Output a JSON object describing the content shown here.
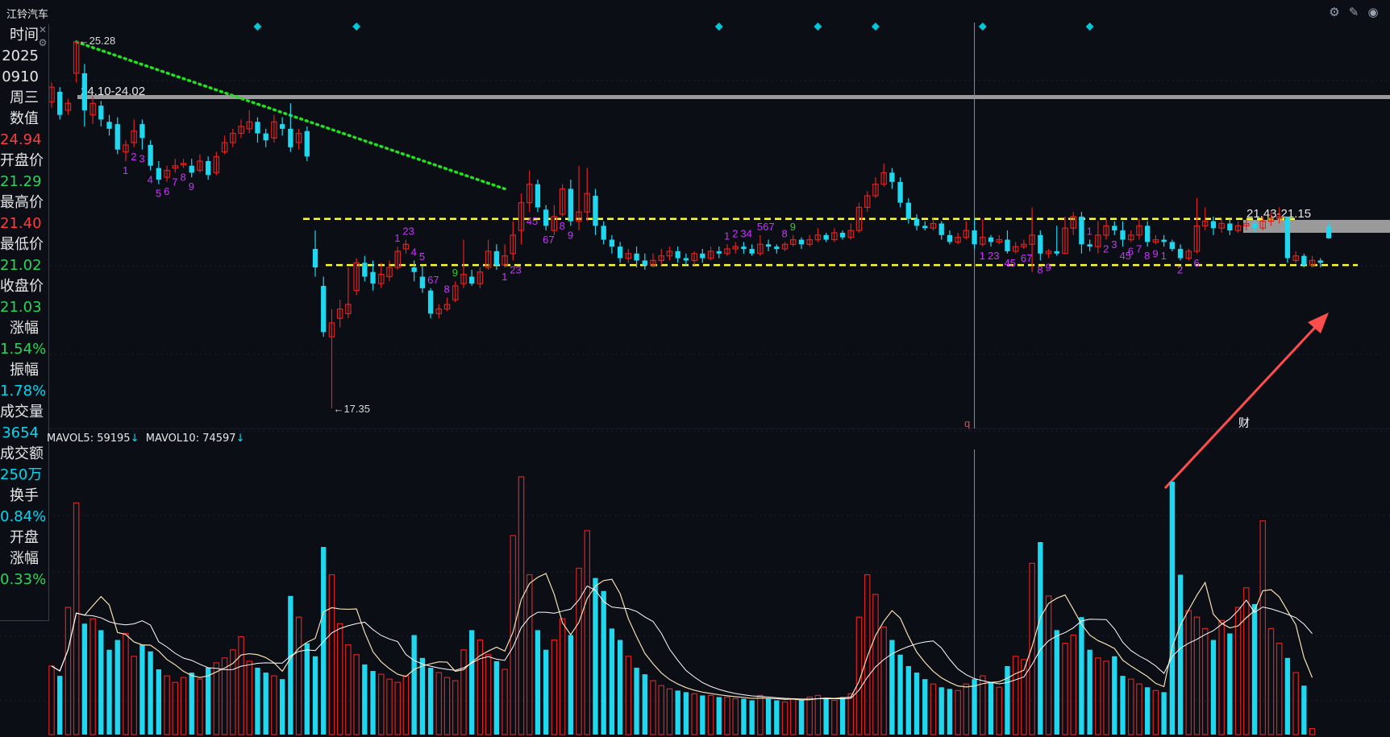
{
  "window": {
    "stock_name": "江铃汽车",
    "icons": [
      "settings-icon",
      "draw-pen-icon",
      "eye-icon"
    ]
  },
  "info_panel": {
    "rows": [
      {
        "label": "时间",
        "value": "2025",
        "color": "#e6e6e6"
      },
      {
        "label": "",
        "value": "0910",
        "color": "#e6e6e6"
      },
      {
        "label": "",
        "value": "周三",
        "color": "#e6e6e6"
      },
      {
        "label": "数值",
        "value": "24.94",
        "color": "#ff3b3b"
      },
      {
        "label": "开盘价",
        "value": "21.29",
        "color": "#2bd45a"
      },
      {
        "label": "最高价",
        "value": "21.40",
        "color": "#ff3b3b"
      },
      {
        "label": "最低价",
        "value": "21.02",
        "color": "#2bd45a"
      },
      {
        "label": "收盘价",
        "value": "21.03",
        "color": "#2bd45a"
      },
      {
        "label": "涨幅",
        "value": "1.54%",
        "color": "#2bd45a"
      },
      {
        "label": "振幅",
        "value": "1.78%",
        "color": "#00d8f0"
      },
      {
        "label": "成交量",
        "value": "3654",
        "color": "#00d8f0"
      },
      {
        "label": "成交额",
        "value": "250万",
        "color": "#00d8f0"
      },
      {
        "label": "换手",
        "value": "0.84%",
        "color": "#00d8f0"
      },
      {
        "label": "开盘",
        "value": "",
        "color": "#e6e6e6"
      },
      {
        "label": "涨幅",
        "value": "0.33%",
        "color": "#2bd45a"
      }
    ]
  },
  "volume_legend": {
    "mavol5_label": "MAVOL5: 59195",
    "mavol10_label": "MAVOL10: 74597",
    "arrow": "↓"
  },
  "colors": {
    "up": "#e02020",
    "down": "#1fd8f0",
    "trendline": "#20e020",
    "support": "#ffff33",
    "td_count": "#cc33ff",
    "td_green": "#33cc33",
    "annotation_arrow": "#ff4d4d",
    "marker": "#00c8d8",
    "resistance_band": "#9a9a9a",
    "mavol5": "#f5deb3",
    "mavol10": "#ffffff"
  },
  "chart_data": {
    "type": "candlestick",
    "price_axis_visible": false,
    "annotations": {
      "high_label": "←25.28",
      "low_label": "←17.35",
      "resistance_left": "24.10-24.02",
      "resistance_right": "21.43-21.15",
      "finance_marker": "财",
      "q_marker": "q"
    },
    "support_levels": [
      21.45,
      20.45
    ],
    "candles": [
      [
        23.98,
        24.3,
        24.4,
        23.85
      ],
      [
        24.2,
        23.7,
        24.3,
        23.6
      ],
      [
        23.8,
        23.95,
        24.05,
        23.7
      ],
      [
        24.6,
        25.28,
        25.28,
        24.4
      ],
      [
        24.6,
        23.8,
        24.8,
        23.45
      ],
      [
        23.7,
        23.95,
        24.1,
        23.5
      ],
      [
        23.9,
        23.6,
        24.0,
        23.45
      ],
      [
        23.55,
        23.4,
        23.7,
        23.25
      ],
      [
        23.5,
        22.95,
        23.65,
        22.85
      ],
      [
        22.9,
        23.05,
        23.15,
        22.7
      ],
      [
        23.1,
        23.35,
        23.6,
        23.0
      ],
      [
        23.5,
        23.2,
        23.6,
        22.95
      ],
      [
        23.05,
        22.6,
        23.15,
        22.5
      ],
      [
        22.55,
        22.3,
        22.7,
        22.2
      ],
      [
        22.35,
        22.5,
        22.6,
        22.25
      ],
      [
        22.55,
        22.6,
        22.75,
        22.45
      ],
      [
        22.62,
        22.65,
        22.75,
        22.55
      ],
      [
        22.6,
        22.45,
        22.75,
        22.35
      ],
      [
        22.5,
        22.7,
        22.85,
        22.45
      ],
      [
        22.7,
        22.4,
        22.8,
        22.3
      ],
      [
        22.45,
        22.8,
        22.9,
        22.4
      ],
      [
        22.9,
        23.1,
        23.25,
        22.85
      ],
      [
        23.1,
        23.3,
        23.4,
        23.0
      ],
      [
        23.3,
        23.45,
        23.6,
        23.2
      ],
      [
        23.4,
        23.55,
        23.8,
        23.3
      ],
      [
        23.55,
        23.3,
        23.65,
        23.1
      ],
      [
        23.3,
        23.15,
        23.4,
        23.0
      ],
      [
        23.2,
        23.55,
        23.7,
        23.1
      ],
      [
        23.5,
        23.4,
        23.65,
        23.25
      ],
      [
        23.4,
        23.0,
        23.95,
        22.9
      ],
      [
        23.1,
        23.3,
        23.4,
        22.95
      ],
      [
        23.35,
        22.8,
        23.45,
        22.7
      ],
      [
        20.8,
        20.4,
        21.2,
        20.2
      ],
      [
        20.0,
        19.0,
        20.2,
        18.9
      ],
      [
        18.9,
        19.2,
        19.5,
        17.35
      ],
      [
        19.3,
        19.5,
        19.7,
        19.1
      ],
      [
        19.4,
        19.6,
        20.4,
        19.3
      ],
      [
        19.9,
        20.5,
        20.6,
        19.8
      ],
      [
        20.5,
        20.2,
        20.65,
        20.1
      ],
      [
        20.3,
        20.05,
        20.55,
        19.9
      ],
      [
        20.05,
        20.25,
        20.5,
        19.95
      ],
      [
        20.2,
        20.4,
        20.55,
        20.1
      ],
      [
        20.4,
        20.75,
        20.85,
        20.35
      ],
      [
        20.8,
        20.9,
        21.0,
        20.7
      ],
      [
        20.4,
        20.3,
        20.55,
        20.1
      ],
      [
        20.2,
        19.95,
        20.45,
        19.85
      ],
      [
        19.9,
        19.4,
        19.95,
        19.3
      ],
      [
        19.4,
        19.5,
        19.6,
        19.3
      ],
      [
        19.5,
        19.6,
        19.75,
        19.45
      ],
      [
        19.7,
        20.0,
        20.1,
        19.65
      ],
      [
        20.05,
        20.25,
        21.0,
        19.95
      ],
      [
        20.2,
        20.05,
        20.35,
        20.0
      ],
      [
        20.05,
        20.3,
        20.4,
        19.95
      ],
      [
        20.4,
        20.75,
        21.0,
        20.35
      ],
      [
        20.75,
        20.45,
        20.9,
        20.35
      ],
      [
        20.45,
        20.65,
        20.9,
        20.4
      ],
      [
        20.7,
        21.1,
        21.4,
        20.55
      ],
      [
        21.2,
        21.8,
        22.0,
        20.9
      ],
      [
        21.8,
        22.2,
        22.5,
        21.6
      ],
      [
        22.2,
        21.7,
        22.3,
        21.6
      ],
      [
        21.65,
        21.3,
        21.75,
        21.2
      ],
      [
        21.2,
        21.5,
        21.75,
        21.1
      ],
      [
        21.55,
        22.1,
        22.2,
        21.5
      ],
      [
        22.1,
        21.4,
        22.3,
        21.3
      ],
      [
        21.4,
        21.6,
        22.6,
        21.2
      ],
      [
        21.6,
        22.0,
        22.55,
        21.4
      ],
      [
        21.95,
        21.3,
        22.1,
        21.1
      ],
      [
        21.3,
        21.0,
        21.4,
        20.9
      ],
      [
        21.0,
        20.85,
        21.1,
        20.7
      ],
      [
        20.85,
        20.6,
        20.95,
        20.5
      ],
      [
        20.6,
        20.7,
        20.8,
        20.5
      ],
      [
        20.7,
        20.55,
        20.85,
        20.4
      ],
      [
        20.55,
        20.45,
        20.7,
        20.35
      ],
      [
        20.45,
        20.55,
        20.7,
        20.4
      ],
      [
        20.55,
        20.65,
        20.8,
        20.45
      ],
      [
        20.65,
        20.75,
        20.85,
        20.55
      ],
      [
        20.75,
        20.6,
        20.85,
        20.5
      ],
      [
        20.6,
        20.55,
        20.7,
        20.45
      ],
      [
        20.55,
        20.7,
        20.75,
        20.45
      ],
      [
        20.7,
        20.6,
        20.8,
        20.5
      ],
      [
        20.6,
        20.75,
        20.85,
        20.55
      ],
      [
        20.75,
        20.7,
        20.85,
        20.6
      ],
      [
        20.7,
        20.8,
        20.9,
        20.65
      ],
      [
        20.8,
        20.85,
        20.95,
        20.7
      ],
      [
        20.85,
        20.8,
        20.95,
        20.7
      ],
      [
        20.8,
        20.7,
        20.9,
        20.65
      ],
      [
        20.7,
        20.9,
        21.1,
        20.65
      ],
      [
        20.9,
        20.85,
        21.0,
        20.75
      ],
      [
        20.85,
        20.8,
        20.9,
        20.7
      ],
      [
        20.8,
        20.9,
        20.95,
        20.75
      ],
      [
        20.9,
        21.0,
        21.1,
        20.85
      ],
      [
        21.0,
        20.9,
        21.05,
        20.8
      ],
      [
        20.9,
        21.0,
        21.1,
        20.85
      ],
      [
        21.0,
        21.1,
        21.25,
        20.95
      ],
      [
        21.1,
        21.0,
        21.15,
        20.95
      ],
      [
        21.0,
        21.15,
        21.25,
        20.95
      ],
      [
        21.15,
        21.05,
        21.2,
        21.0
      ],
      [
        21.05,
        21.2,
        21.35,
        21.0
      ],
      [
        21.2,
        21.7,
        21.8,
        21.15
      ],
      [
        21.7,
        21.95,
        22.05,
        21.6
      ],
      [
        21.95,
        22.2,
        22.35,
        21.9
      ],
      [
        22.2,
        22.45,
        22.65,
        22.15
      ],
      [
        22.45,
        22.25,
        22.55,
        22.1
      ],
      [
        22.25,
        21.8,
        22.35,
        21.7
      ],
      [
        21.8,
        21.45,
        21.9,
        21.35
      ],
      [
        21.45,
        21.3,
        21.55,
        21.2
      ],
      [
        21.3,
        21.25,
        21.4,
        21.2
      ],
      [
        21.25,
        21.35,
        21.45,
        21.2
      ],
      [
        21.35,
        21.1,
        21.4,
        21.0
      ],
      [
        21.1,
        20.95,
        21.2,
        20.9
      ],
      [
        20.95,
        21.05,
        21.15,
        20.9
      ],
      [
        21.05,
        21.2,
        21.4,
        21.0
      ],
      [
        21.2,
        20.9,
        21.45,
        20.8
      ],
      [
        20.9,
        21.05,
        21.45,
        20.85
      ],
      [
        21.05,
        20.95,
        21.1,
        20.85
      ],
      [
        20.95,
        21.0,
        21.1,
        20.9
      ],
      [
        21.0,
        20.75,
        21.2,
        20.7
      ],
      [
        20.75,
        20.85,
        20.95,
        20.7
      ],
      [
        20.85,
        20.9,
        21.0,
        20.8
      ],
      [
        20.9,
        21.1,
        21.7,
        20.3
      ],
      [
        21.1,
        20.7,
        21.2,
        20.55
      ],
      [
        20.7,
        20.75,
        20.8,
        20.6
      ],
      [
        20.75,
        20.7,
        21.3,
        20.65
      ],
      [
        20.7,
        21.25,
        21.5,
        20.7
      ],
      [
        21.25,
        21.5,
        21.6,
        21.1
      ],
      [
        21.5,
        20.9,
        21.6,
        20.7
      ],
      [
        20.9,
        20.85,
        21.0,
        20.75
      ],
      [
        20.85,
        21.1,
        21.4,
        20.7
      ],
      [
        21.1,
        21.3,
        21.45,
        21.0
      ],
      [
        21.3,
        21.2,
        21.4,
        21.1
      ],
      [
        21.2,
        21.0,
        21.4,
        20.85
      ],
      [
        21.0,
        21.1,
        21.2,
        20.95
      ],
      [
        21.1,
        21.3,
        21.45,
        21.0
      ],
      [
        21.3,
        20.95,
        21.4,
        20.85
      ],
      [
        20.95,
        21.0,
        21.1,
        20.9
      ],
      [
        21.0,
        20.95,
        21.1,
        20.85
      ],
      [
        20.95,
        20.8,
        21.0,
        20.75
      ],
      [
        20.8,
        20.6,
        20.9,
        20.55
      ],
      [
        20.6,
        20.75,
        20.8,
        20.55
      ],
      [
        20.75,
        21.3,
        21.9,
        20.7
      ],
      [
        21.3,
        21.4,
        21.7,
        21.2
      ],
      [
        21.4,
        21.25,
        21.5,
        21.1
      ],
      [
        21.25,
        21.35,
        21.45,
        21.15
      ],
      [
        21.35,
        21.2,
        21.45,
        21.1
      ],
      [
        21.2,
        21.3,
        21.4,
        21.15
      ],
      [
        21.3,
        21.35,
        21.45,
        21.2
      ],
      [
        21.35,
        21.25,
        21.4,
        21.15
      ],
      [
        21.25,
        21.4,
        21.5,
        21.2
      ],
      [
        21.4,
        21.45,
        21.6,
        21.3
      ],
      [
        21.45,
        21.5,
        21.7,
        21.35
      ],
      [
        21.5,
        20.6,
        21.5,
        20.5
      ],
      [
        20.55,
        20.65,
        20.75,
        20.5
      ],
      [
        20.65,
        20.45,
        20.7,
        20.4
      ],
      [
        20.45,
        20.55,
        20.65,
        20.4
      ],
      [
        20.55,
        20.5,
        20.6,
        20.4
      ],
      [
        21.29,
        21.03,
        21.4,
        21.02
      ]
    ],
    "volume": [
      42000,
      36000,
      78000,
      142000,
      68000,
      71000,
      64000,
      52000,
      58000,
      62000,
      48000,
      55000,
      51000,
      40000,
      36000,
      32000,
      35000,
      38000,
      34000,
      41000,
      44000,
      47000,
      52000,
      60000,
      45000,
      41000,
      38000,
      36000,
      34000,
      85000,
      72000,
      56000,
      48000,
      115000,
      98000,
      68000,
      55000,
      49000,
      43000,
      39000,
      37000,
      34000,
      32000,
      36000,
      61000,
      47000,
      41000,
      38000,
      35000,
      33000,
      52000,
      64000,
      58000,
      49000,
      45000,
      40000,
      122000,
      158000,
      98000,
      64000,
      52000,
      58000,
      71000,
      61000,
      102000,
      125000,
      96000,
      88000,
      65000,
      58000,
      48000,
      41000,
      37000,
      33000,
      30000,
      28000,
      27000,
      26000,
      25000,
      24000,
      24000,
      23000,
      23000,
      22000,
      22000,
      21000,
      24000,
      22000,
      21000,
      20000,
      22000,
      21000,
      23000,
      24000,
      22000,
      21000,
      23000,
      25000,
      72000,
      98000,
      86000,
      66000,
      58000,
      49000,
      42000,
      38000,
      34000,
      31000,
      29000,
      28000,
      27000,
      31000,
      34000,
      36000,
      32000,
      29000,
      42000,
      48000,
      46000,
      105000,
      118000,
      85000,
      64000,
      56000,
      61000,
      72000,
      52000,
      47000,
      45000,
      48000,
      36000,
      34000,
      31000,
      29000,
      27000,
      26000,
      155000,
      98000,
      76000,
      72000,
      65000,
      58000,
      70000,
      62000,
      78000,
      90000,
      80000,
      131000,
      65000,
      56000,
      47000,
      38000,
      30000,
      3654
    ],
    "td_markers": [
      {
        "i": 9,
        "n": "1",
        "pos": "below"
      },
      {
        "i": 10,
        "n": "2",
        "pos": "below"
      },
      {
        "i": 11,
        "n": "3",
        "pos": "below"
      },
      {
        "i": 12,
        "n": "4",
        "pos": "below"
      },
      {
        "i": 13,
        "n": "5",
        "pos": "below"
      },
      {
        "i": 14,
        "n": "6",
        "pos": "below"
      },
      {
        "i": 15,
        "n": "7",
        "pos": "below"
      },
      {
        "i": 16,
        "n": "8",
        "pos": "below"
      },
      {
        "i": 17,
        "n": "9",
        "pos": "below"
      },
      {
        "i": 42,
        "n": "1",
        "pos": "above"
      },
      {
        "i": 43,
        "n": "23",
        "pos": "above"
      },
      {
        "i": 44,
        "n": "4",
        "pos": "above"
      },
      {
        "i": 45,
        "n": "5",
        "pos": "above"
      },
      {
        "i": 46,
        "n": "67",
        "pos": "above"
      },
      {
        "i": 48,
        "n": "8",
        "pos": "above"
      },
      {
        "i": 49,
        "n": "9",
        "pos": "above",
        "color": "green"
      },
      {
        "i": 55,
        "n": "1",
        "pos": "below"
      },
      {
        "i": 56,
        "n": "23",
        "pos": "below"
      },
      {
        "i": 58,
        "n": "45",
        "pos": "below"
      },
      {
        "i": 60,
        "n": "67",
        "pos": "below"
      },
      {
        "i": 62,
        "n": "8",
        "pos": "below"
      },
      {
        "i": 63,
        "n": "9",
        "pos": "below"
      },
      {
        "i": 82,
        "n": "1",
        "pos": "above"
      },
      {
        "i": 83,
        "n": "2",
        "pos": "above"
      },
      {
        "i": 84,
        "n": "34",
        "pos": "above"
      },
      {
        "i": 86,
        "n": "567",
        "pos": "above"
      },
      {
        "i": 89,
        "n": "8",
        "pos": "above"
      },
      {
        "i": 90,
        "n": "9",
        "pos": "above",
        "color": "green"
      },
      {
        "i": 113,
        "n": "1",
        "pos": "below"
      },
      {
        "i": 114,
        "n": "23",
        "pos": "below"
      },
      {
        "i": 116,
        "n": "45",
        "pos": "below"
      },
      {
        "i": 118,
        "n": "67",
        "pos": "below"
      },
      {
        "i": 120,
        "n": "8",
        "pos": "below"
      },
      {
        "i": 121,
        "n": "9",
        "pos": "below"
      },
      {
        "i": 126,
        "n": "1",
        "pos": "above"
      },
      {
        "i": 128,
        "n": "2",
        "pos": "below"
      },
      {
        "i": 129,
        "n": "3",
        "pos": "below"
      },
      {
        "i": 130,
        "n": "45",
        "pos": "below"
      },
      {
        "i": 131,
        "n": "6",
        "pos": "below"
      },
      {
        "i": 132,
        "n": "7",
        "pos": "below"
      },
      {
        "i": 133,
        "n": "8",
        "pos": "below"
      },
      {
        "i": 134,
        "n": "9",
        "pos": "below"
      },
      {
        "i": 135,
        "n": "1",
        "pos": "below"
      },
      {
        "i": 137,
        "n": "2",
        "pos": "below"
      },
      {
        "i": 139,
        "n": "6",
        "pos": "below"
      }
    ],
    "diamond_markers": [
      25,
      37,
      81,
      93,
      100,
      113,
      126
    ],
    "trendline": {
      "from": [
        3,
        25.28
      ],
      "to": [
        55,
        22.1
      ]
    },
    "crosshair_index": 112
  }
}
